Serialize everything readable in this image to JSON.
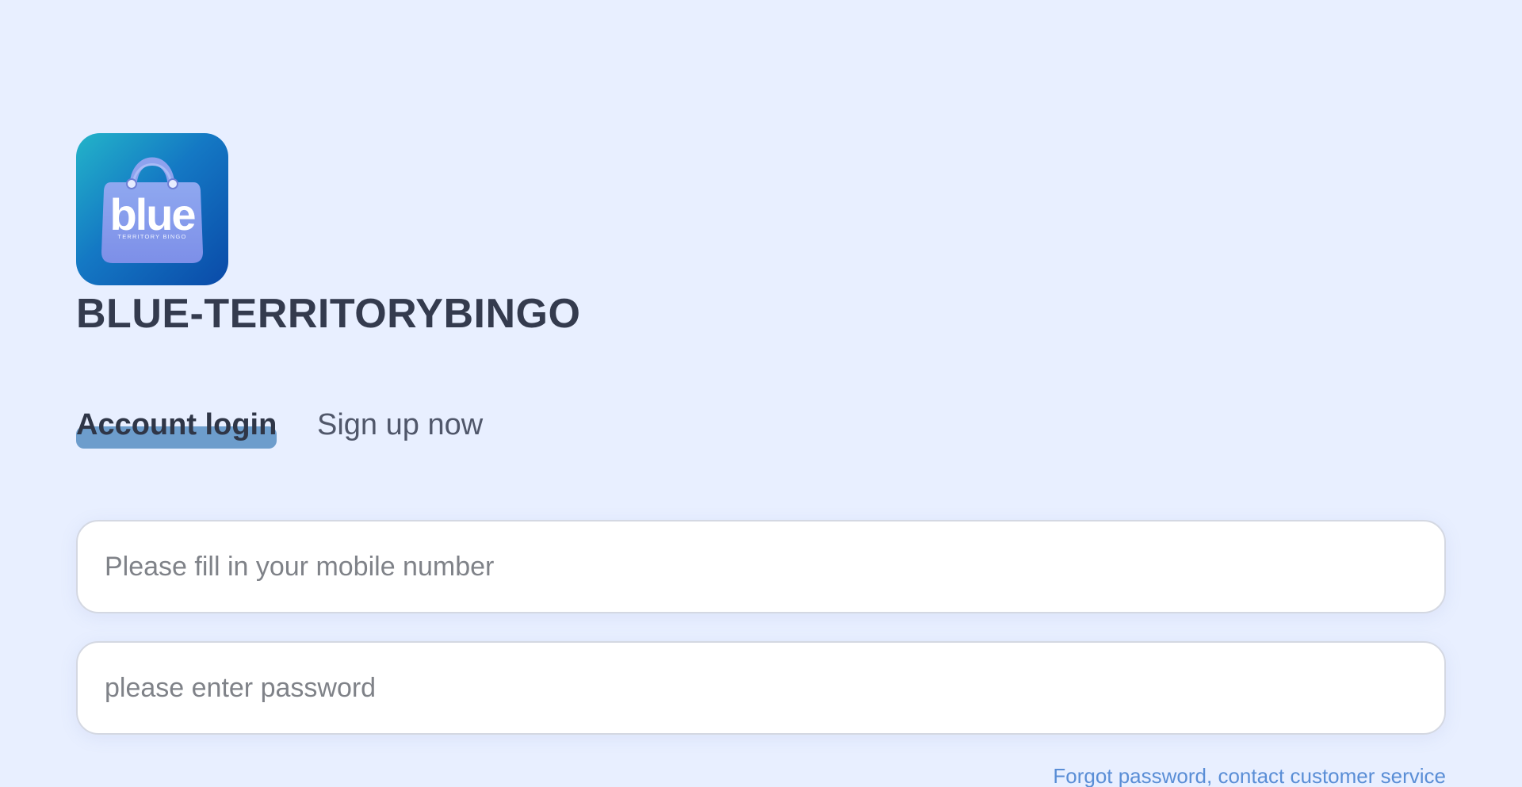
{
  "brand": {
    "logo_icon": "shopping-bag-icon",
    "logo_text": "blue",
    "logo_subtext": "TERRITORY BINGO",
    "name": "BLUE-TERRITORYBINGO"
  },
  "tabs": {
    "login_label": "Account login",
    "signup_label": "Sign up now",
    "active": "login"
  },
  "form": {
    "phone": {
      "placeholder": "Please fill in your mobile number",
      "value": ""
    },
    "password": {
      "placeholder": "please enter password",
      "value": ""
    }
  },
  "links": {
    "forgot_password": "Forgot password, contact customer service"
  },
  "colors": {
    "background": "#e8efff",
    "tab_underline": "#6d9dcc",
    "link": "#5a8ed6",
    "heading": "#343b4e"
  }
}
